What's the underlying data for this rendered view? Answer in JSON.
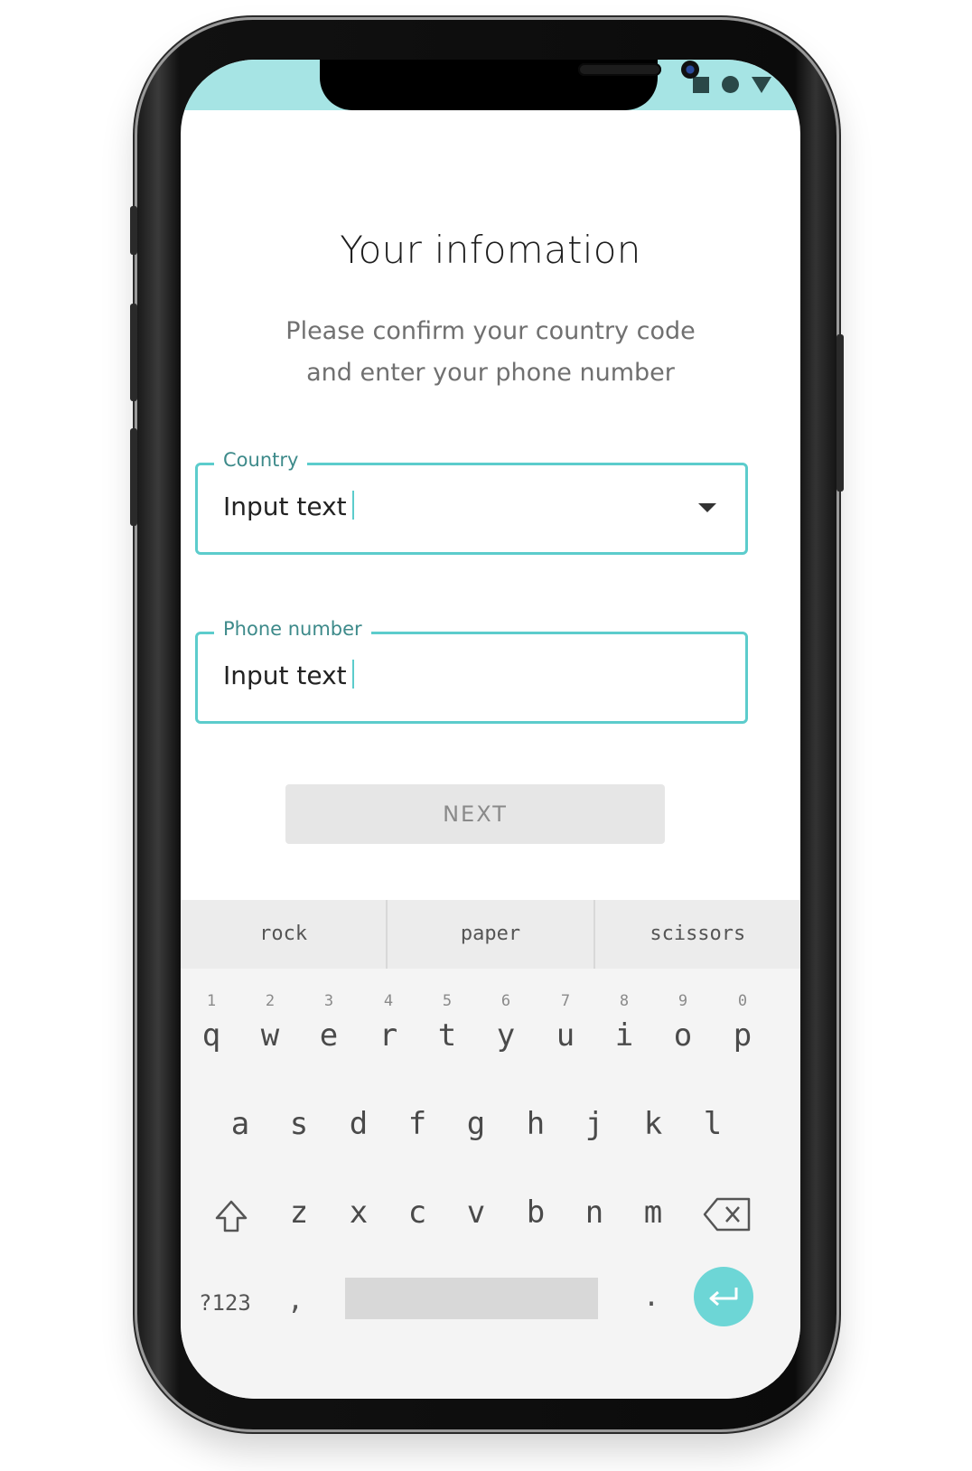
{
  "status_bar": {
    "icons": [
      "square-icon",
      "circle-icon",
      "triangle-icon"
    ],
    "color": "#a6e4e4"
  },
  "header": {
    "title": "Your infomation",
    "subtitle_line1": "Please confirm your country code",
    "subtitle_line2": "and enter your phone number"
  },
  "form": {
    "country": {
      "label": "Country",
      "value": "Input text"
    },
    "phone": {
      "label": "Phone number",
      "value": "Input text"
    },
    "next_label": "NEXT"
  },
  "keyboard": {
    "suggestions": [
      "rock",
      "paper",
      "scissors"
    ],
    "row1": [
      {
        "k": "q",
        "h": "1"
      },
      {
        "k": "w",
        "h": "2"
      },
      {
        "k": "e",
        "h": "3"
      },
      {
        "k": "r",
        "h": "4"
      },
      {
        "k": "t",
        "h": "5"
      },
      {
        "k": "y",
        "h": "6"
      },
      {
        "k": "u",
        "h": "7"
      },
      {
        "k": "i",
        "h": "8"
      },
      {
        "k": "o",
        "h": "9"
      },
      {
        "k": "p",
        "h": "0"
      }
    ],
    "row2": [
      "a",
      "s",
      "d",
      "f",
      "g",
      "h",
      "j",
      "k",
      "l"
    ],
    "row3": [
      "z",
      "x",
      "c",
      "v",
      "b",
      "n",
      "m"
    ],
    "symbols_label": "?123",
    "comma_label": ",",
    "period_label": ".",
    "accent": "#6dd6d6"
  }
}
